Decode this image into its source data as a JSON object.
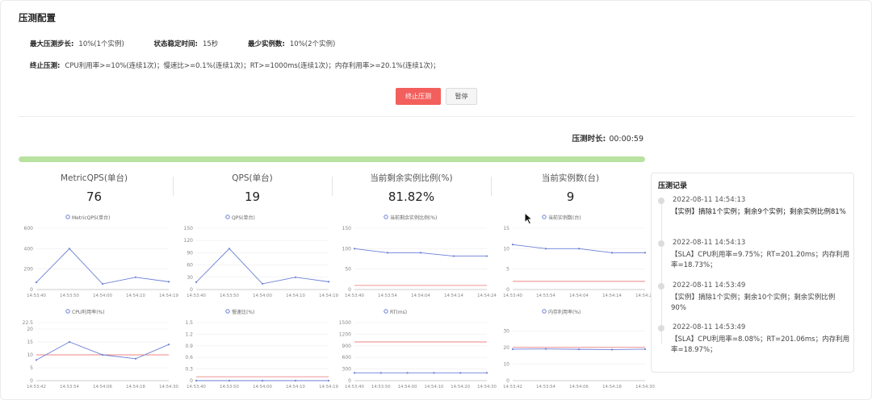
{
  "page": {
    "title": "压测配置"
  },
  "config": {
    "step_label": "最大压测步长:",
    "step_value": "10%(1个实例)",
    "stable_label": "状态稳定时间:",
    "stable_value": "15秒",
    "min_label": "最少实例数:",
    "min_value": "10%(2个实例)",
    "stop_label": "终止压测:",
    "stop_value": "CPU利用率>=10%(连续1次)；慢速比>=0.1%(连续1次)；RT>=1000ms(连续1次)；内存利用率>=20.1%(连续1次)；"
  },
  "buttons": {
    "stop": "终止压测",
    "pause": "暂停"
  },
  "duration": {
    "label": "压测时长:",
    "value": "00:00:59"
  },
  "progress": {
    "percent": 100,
    "color": "#b9e2a0"
  },
  "stats": [
    {
      "label": "MetricQPS(单台)",
      "value": "76"
    },
    {
      "label": "QPS(单台)",
      "value": "19"
    },
    {
      "label": "当前剩余实例比例(%)",
      "value": "81.82%"
    },
    {
      "label": "当前实例数(台)",
      "value": "9"
    }
  ],
  "colors": {
    "series": "#6b7fd7",
    "threshold": "#ec8686",
    "axis": "#999999",
    "grid": "#eeeeee"
  },
  "chart_data": [
    {
      "type": "line",
      "legend": "MetricQPS(单台)",
      "x": [
        "14:53:40",
        "14:53:50",
        "14:54:00",
        "14:54:10",
        "14:54:19"
      ],
      "values": [
        70,
        400,
        55,
        120,
        76
      ],
      "yticks": [
        0,
        200,
        400,
        600
      ],
      "ylim": [
        0,
        600
      ]
    },
    {
      "type": "line",
      "legend": "QPS(单台)",
      "x": [
        "14:53:40",
        "14:53:50",
        "14:54:00",
        "14:54:10",
        "14:54:19"
      ],
      "values": [
        18,
        100,
        14,
        30,
        19
      ],
      "yticks": [
        0,
        30,
        60,
        90,
        120,
        150
      ],
      "ylim": [
        0,
        150
      ]
    },
    {
      "type": "line",
      "legend": "当前剩余实例比例(%)",
      "x": [
        "14:53:40",
        "14:53:54",
        "14:54:04",
        "14:54:14",
        "14:54:24"
      ],
      "values": [
        100,
        90,
        90,
        81.82,
        81.82
      ],
      "threshold": 10,
      "yticks": [
        0,
        50,
        100,
        150
      ],
      "ylim": [
        0,
        150
      ]
    },
    {
      "type": "line",
      "legend": "当前实例数(台)",
      "x": [
        "14:53:40",
        "14:53:54",
        "14:54:04",
        "14:54:14",
        "14:54:24"
      ],
      "values": [
        11,
        10,
        10,
        9,
        9
      ],
      "threshold": 2,
      "yticks": [
        0,
        5,
        10,
        15
      ],
      "ylim": [
        0,
        15
      ]
    },
    {
      "type": "line",
      "legend": "CPU利用率(%)",
      "x": [
        "14:53:42",
        "14:53:54",
        "14:54:06",
        "14:54:18",
        "14:54:30"
      ],
      "values": [
        8,
        15,
        10,
        8.5,
        14
      ],
      "threshold": 10,
      "yticks": [
        0,
        5,
        10,
        15,
        20,
        22.5
      ],
      "ylim": [
        0,
        22.5
      ]
    },
    {
      "type": "line",
      "legend": "慢速比(%)",
      "x": [
        "14:53:40",
        "14:53:50",
        "14:54:00",
        "14:54:10",
        "14:54:19"
      ],
      "values": [
        0,
        0,
        0,
        0,
        0
      ],
      "threshold": 0.1,
      "yticks": [
        0,
        0.3,
        0.6,
        0.9,
        1.2,
        1.5
      ],
      "ylim": [
        0,
        1.5
      ]
    },
    {
      "type": "line",
      "legend": "RT(ms)",
      "x": [
        "14:53:40",
        "14:53:50",
        "14:54:00",
        "14:54:10",
        "14:54:20",
        "14:54:30"
      ],
      "values": [
        201,
        201,
        201,
        201,
        201,
        201
      ],
      "threshold": 1000,
      "yticks": [
        0,
        300,
        600,
        900,
        1200,
        1500
      ],
      "ylim": [
        0,
        1500
      ]
    },
    {
      "type": "line",
      "legend": "内存利用率(%)",
      "x": [
        "14:53:42",
        "14:53:54",
        "14:54:06",
        "14:54:18",
        "14:54:30"
      ],
      "values": [
        18.97,
        19.1,
        18.9,
        18.73,
        19.0
      ],
      "threshold": 20.1,
      "yticks": [
        0,
        10,
        20,
        30
      ],
      "ylim": [
        0,
        35
      ]
    }
  ],
  "log": {
    "title": "压测记录",
    "entries": [
      {
        "time": "2022-08-11 14:54:13",
        "message": "【实例】摘除1个实例；剩余9个实例；剩余实例比例81%",
        "dark": true
      },
      {
        "time": "2022-08-11 14:54:13",
        "message": "【SLA】CPU利用率=9.75%；RT=201.20ms；内存利用率=18.73%；",
        "dark": false
      },
      {
        "time": "2022-08-11 14:53:49",
        "message": "【实例】摘除1个实例；剩余10个实例；剩余实例比例90%",
        "dark": false
      },
      {
        "time": "2022-08-11 14:53:49",
        "message": "【SLA】CPU利用率=8.08%；RT=201.06ms；内存利用率=18.97%；",
        "dark": false
      }
    ]
  }
}
